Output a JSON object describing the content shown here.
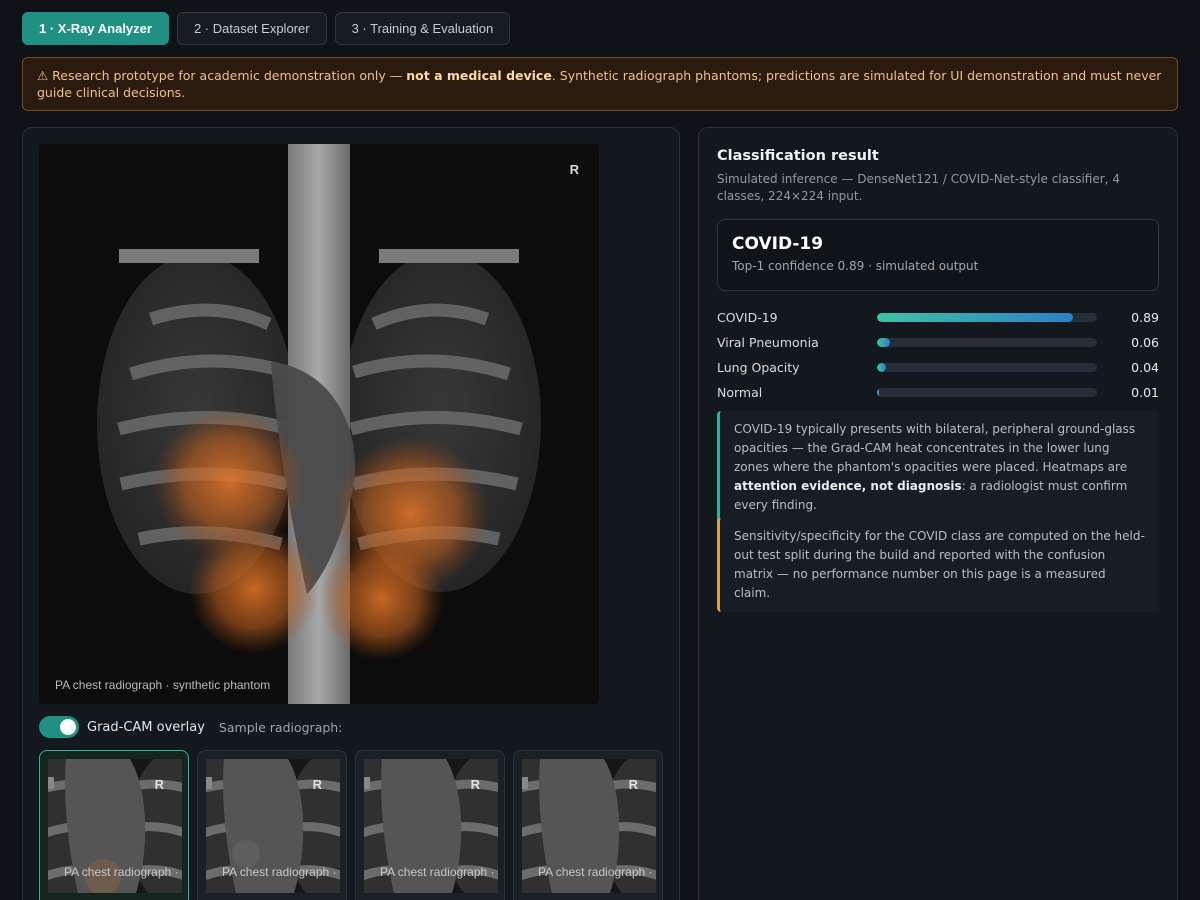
{
  "tabs": [
    {
      "label": "1 · X-Ray Analyzer",
      "active": true
    },
    {
      "label": "2 · Dataset Explorer",
      "active": false
    },
    {
      "label": "3 · Training & Evaluation",
      "active": false
    }
  ],
  "banner": {
    "prefix": "⚠ Research prototype for academic demonstration only — ",
    "bold": "not a medical device",
    "suffix": ". Synthetic radiograph phantoms; predictions are simulated for UI demonstration and must never guide clinical decisions."
  },
  "viewer": {
    "side_marker": "R",
    "caption": "PA chest radiograph · synthetic phantom",
    "overlay_label": "Grad-CAM overlay",
    "overlay_on": true,
    "sample_label": "Sample radiograph:"
  },
  "thumbnails": [
    {
      "marker": "R",
      "caption": "PA chest radiograph · synthetic phantom",
      "selected": true
    },
    {
      "marker": "R",
      "caption": "PA chest radiograph · synthetic phantom",
      "selected": false
    },
    {
      "marker": "R",
      "caption": "PA chest radiograph · synthetic phantom",
      "selected": false
    },
    {
      "marker": "R",
      "caption": "PA chest radiograph · synthetic phantom",
      "selected": false
    }
  ],
  "result": {
    "title": "Classification result",
    "subtitle": "Simulated inference — DenseNet121 / COVID-Net-style classifier, 4 classes, 224×224 input.",
    "top_label": "COVID-19",
    "top_confidence": "Top-1 confidence 0.89 · simulated output",
    "probabilities": [
      {
        "name": "COVID-19",
        "value": 0.89,
        "display": "0.89"
      },
      {
        "name": "Viral Pneumonia",
        "value": 0.06,
        "display": "0.06"
      },
      {
        "name": "Lung Opacity",
        "value": 0.04,
        "display": "0.04"
      },
      {
        "name": "Normal",
        "value": 0.01,
        "display": "0.01"
      }
    ]
  },
  "notes": {
    "info_part1": "COVID-19 typically presents with bilateral, peripheral ground-glass opacities — the Grad-CAM heat concentrates in the lower lung zones where the phantom's opacities were placed. Heatmaps are ",
    "info_bold": "attention evidence, not diagnosis",
    "info_part2": ": a radiologist must confirm every finding.",
    "caveat": "Sensitivity/specificity for the COVID class are computed on the held-out test split during the build and reported with the confusion matrix — no performance number on this page is a measured claim."
  },
  "colors": {
    "accent": "#1f9081",
    "warning_border": "#7a4a1c",
    "heat": "#e8782a"
  }
}
